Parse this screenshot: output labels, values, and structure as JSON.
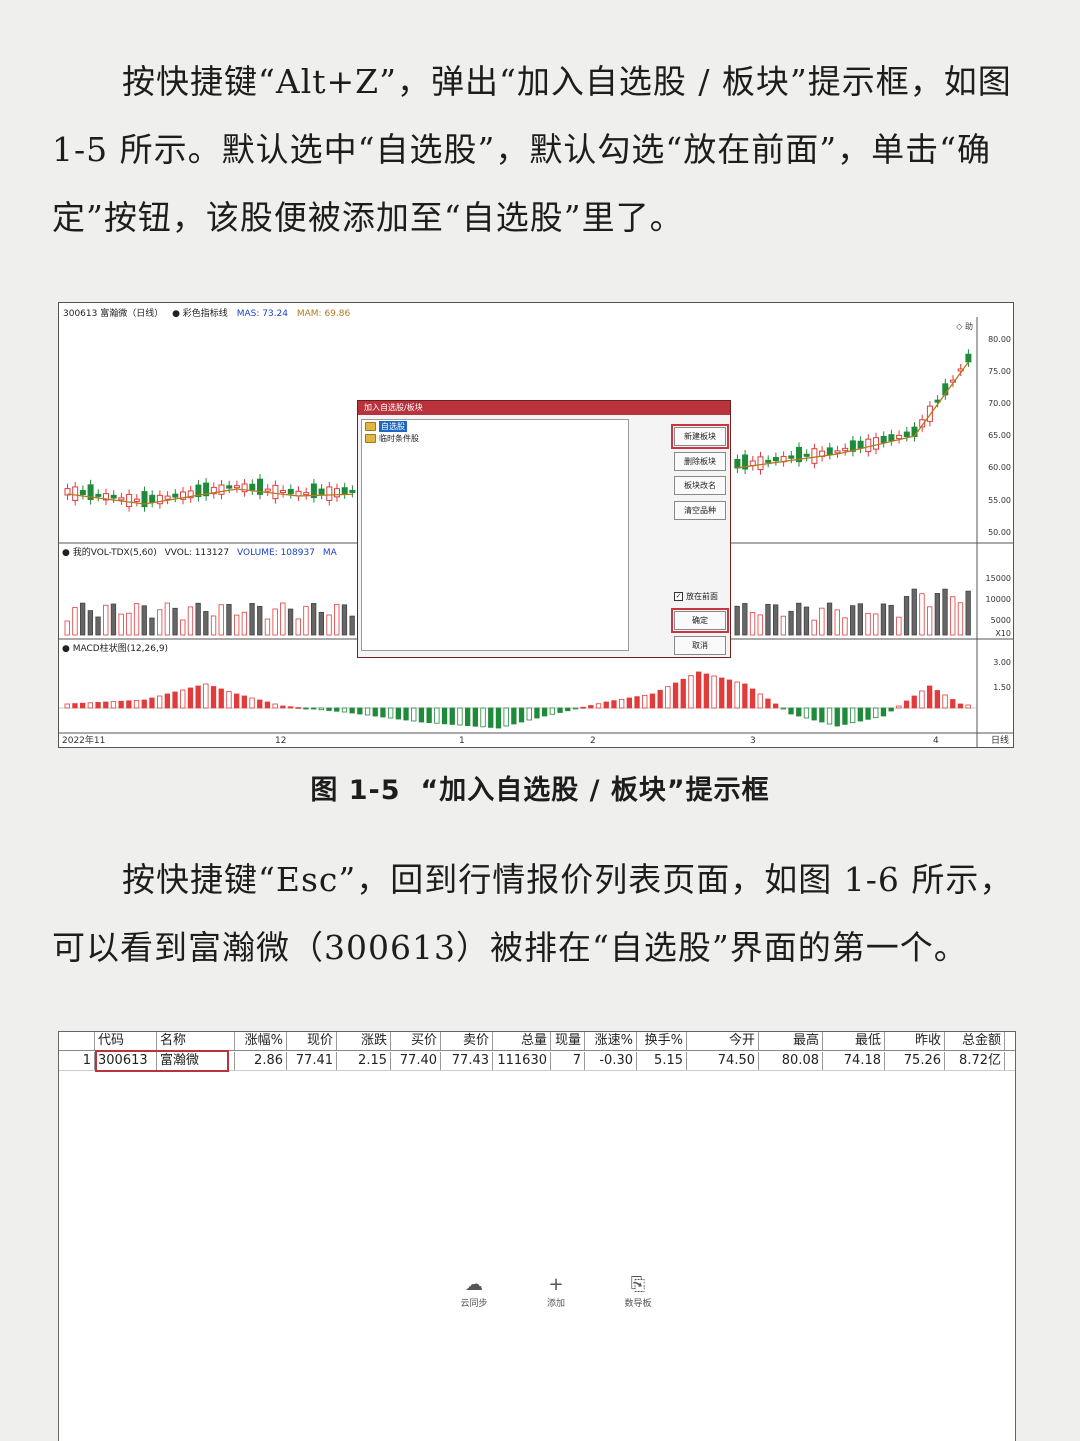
{
  "paragraph1": "按快捷键“Alt+Z”，弹出“加入自选股 / 板块”提示框，如图 1-5 所示。默认选中“自选股”，默认勾选“放在前面”，单击“确定”按钮，该股便被添加至“自选股”里了。",
  "figure1": {
    "caption_number": "图 1-5",
    "caption_text": "“加入自选股 / 板块”提示框",
    "chart_title": {
      "stock": "300613 富瀚微（日线）",
      "indicator": "● 彩色指标线",
      "mas": "MAS: 73.24",
      "mam": "MAM: 69.86"
    },
    "volume_title": {
      "name": "● 我的VOL-TDX(5,60)",
      "vvol": "VVOL: 113127",
      "volume": "VOLUME: 108937",
      "ma": "MA"
    },
    "macd_title": "● MACD柱状图(12,26,9)",
    "price_ticks": [
      "80.00",
      "75.00",
      "70.00",
      "65.00",
      "60.00",
      "55.00",
      "50.00"
    ],
    "volume_ticks": [
      "15000",
      "10000",
      "5000",
      "X10"
    ],
    "macd_ticks": [
      "3.00",
      "1.50"
    ],
    "date_ticks": [
      "2022年11",
      "12",
      "1",
      "2",
      "3",
      "4"
    ],
    "period_label": "日线",
    "corner_label": "◇ 助",
    "dialog": {
      "title": "加入自选股/板块",
      "tree": [
        "自选股",
        "临时条件股"
      ],
      "buttons": [
        "新建板块",
        "删除板块",
        "板块改名",
        "清空品种"
      ],
      "checkbox": "放在前面",
      "confirm": "确定",
      "cancel": "取消"
    },
    "colors": {
      "up": "#e23b3b",
      "down": "#1f8a3a",
      "dialog_title": "#b8333c",
      "highlight": "#c8373f"
    }
  },
  "paragraph2": "按快捷键“Esc”，回到行情报价列表页面，如图 1-6 所示，可以看到富瀚微（300613）被排在“自选股”界面的第一个。",
  "figure2": {
    "headers": [
      "",
      "代码",
      "名称",
      "涨幅%",
      "现价",
      "涨跌",
      "买价",
      "卖价",
      "总量",
      "现量",
      "涨速%",
      "换手%",
      "今开",
      "最高",
      "最低",
      "昨收",
      "总金额"
    ],
    "row": [
      "1",
      "300613",
      "富瀚微",
      "2.86",
      "77.41",
      "2.15",
      "77.40",
      "77.43",
      "111630",
      "7",
      "-0.30",
      "5.15",
      "74.50",
      "80.08",
      "74.18",
      "75.26",
      "8.72亿"
    ],
    "bottom_items": [
      {
        "icon": "cloud-sync-icon",
        "label": "云同步"
      },
      {
        "icon": "plus-icon",
        "label": "添加"
      },
      {
        "icon": "import-icon",
        "label": "数导板"
      }
    ]
  }
}
